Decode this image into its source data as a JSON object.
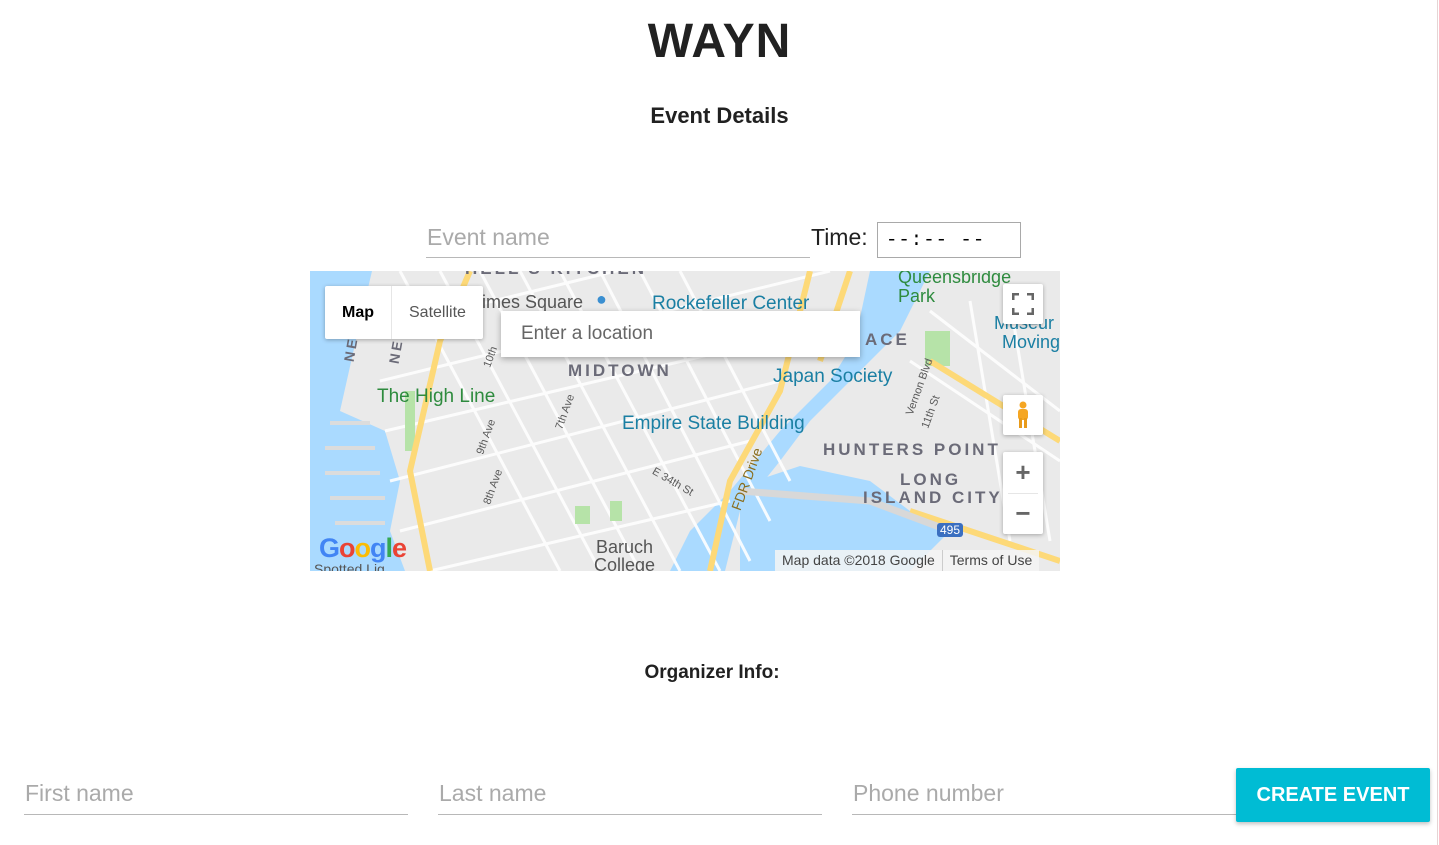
{
  "header": {
    "app_title": "WAYN",
    "section_title": "Event Details"
  },
  "event_form": {
    "event_name_placeholder": "Event name",
    "time_label": "Time:",
    "time_value": "--:--  --"
  },
  "map": {
    "map_type": {
      "map_label": "Map",
      "satellite_label": "Satellite",
      "selected": "Map"
    },
    "location_placeholder": "Enter a location",
    "labels": {
      "kitchen": "HELL'S KITCHEN",
      "times_square": "imes Square",
      "rockefeller": "Rockefeller Center",
      "queensbridge": "Queensbridge",
      "park": "Park",
      "museum": "Museur",
      "moving": "Moving",
      "place": "ACE",
      "midtown": "MIDTOWN",
      "japan_society": "Japan Society",
      "high_line": "The High Line",
      "empire": "Empire State Building",
      "hunters_point": "HUNTERS POINT",
      "long": "LONG",
      "island_city": "ISLAND CITY",
      "baruch": "Baruch",
      "college": "College",
      "spotted": "Spotted Lig",
      "fdr": "FDR Drive",
      "tenth_ave": "10th",
      "ninth_ave": "9th Ave",
      "eighth_ave": "8th Ave",
      "seventh_ave": "7th Ave",
      "e34": "E 34th St",
      "vernon": "Vernon Blvd",
      "eleventh": "11th St",
      "ne1": "NE",
      "ne2": "NE",
      "i495": "495"
    },
    "attribution": {
      "data": "Map data ©2018 Google",
      "terms": "Terms of Use"
    },
    "logo_text": "Google",
    "colors": {
      "water": "#aadaff",
      "land": "#eaeaea",
      "park": "#b6e3a8",
      "highway": "#fdd978"
    }
  },
  "organizer": {
    "title": "Organizer Info:",
    "first_name_placeholder": "First name",
    "last_name_placeholder": "Last name",
    "phone_placeholder": "Phone number"
  },
  "actions": {
    "create_label": "CREATE EVENT",
    "accent_color": "#00bcd4"
  }
}
